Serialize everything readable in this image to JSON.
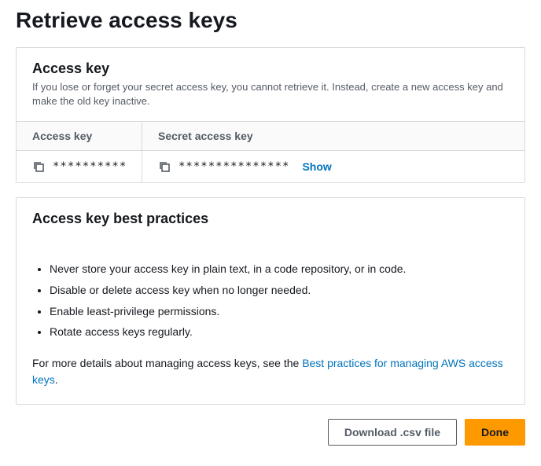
{
  "page": {
    "title": "Retrieve access keys"
  },
  "accessKeyPanel": {
    "title": "Access key",
    "description": "If you lose or forget your secret access key, you cannot retrieve it. Instead, create a new access key and make the old key inactive.",
    "columns": {
      "accessKey": "Access key",
      "secretAccessKey": "Secret access key"
    },
    "values": {
      "accessKey": "**********",
      "secretAccessKey": "***************"
    },
    "showLabel": "Show"
  },
  "bestPractices": {
    "title": "Access key best practices",
    "items": [
      "Never store your access key in plain text, in a code repository, or in code.",
      "Disable or delete access key when no longer needed.",
      "Enable least-privilege permissions.",
      "Rotate access keys regularly."
    ],
    "footerPrefix": "For more details about managing access keys, see the ",
    "footerLink": "Best practices for managing AWS access keys",
    "footerSuffix": "."
  },
  "actions": {
    "download": "Download .csv file",
    "done": "Done"
  }
}
